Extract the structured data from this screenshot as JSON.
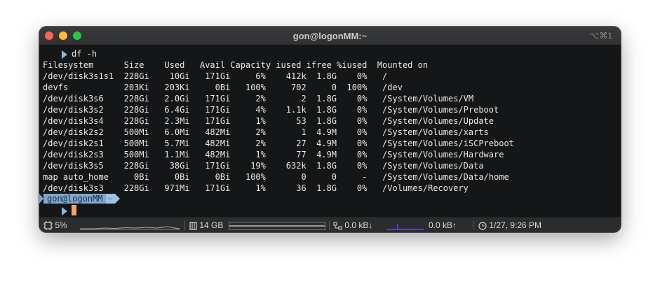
{
  "window": {
    "title": "gon@logonMM:~",
    "shortcut": "⌥⌘1"
  },
  "terminal": {
    "command": "df -h",
    "header": "Filesystem      Size    Used   Avail Capacity iused ifree %iused  Mounted on",
    "rows": [
      "/dev/disk3s1s1  228Gi    10Gi   171Gi     6%    412k  1.8G    0%   /",
      "devfs           203Ki   203Ki     0Bi   100%     702     0  100%   /dev",
      "/dev/disk3s6    228Gi   2.0Gi   171Gi     2%       2  1.8G    0%   /System/Volumes/VM",
      "/dev/disk3s2    228Gi   6.4Gi   171Gi     4%    1.1k  1.8G    0%   /System/Volumes/Preboot",
      "/dev/disk3s4    228Gi   2.3Mi   171Gi     1%      53  1.8G    0%   /System/Volumes/Update",
      "/dev/disk2s2    500Mi   6.0Mi   482Mi     2%       1  4.9M    0%   /System/Volumes/xarts",
      "/dev/disk2s1    500Mi   5.7Mi   482Mi     2%      27  4.9M    0%   /System/Volumes/iSCPreboot",
      "/dev/disk2s3    500Mi   1.1Mi   482Mi     1%      77  4.9M    0%   /System/Volumes/Hardware",
      "/dev/disk3s5    228Gi    38Gi   171Gi    19%    632k  1.8G    0%   /System/Volumes/Data",
      "map auto_home     0Bi     0Bi     0Bi   100%       0     0     -   /System/Volumes/Data/home",
      "/dev/disk3s3    228Gi   971Mi   171Gi     1%      36  1.8G    0%   /Volumes/Recovery"
    ],
    "prompt_user": "gon@logonMM",
    "prompt_dir": "~"
  },
  "statusbar": {
    "cpu": "5%",
    "memory": "14 GB",
    "network_down": "0.0 kB↓",
    "network_up": "0.0 kB↑",
    "clock": "1/27, 9:26 PM"
  },
  "colors": {
    "prompt_user_bg": "#7fa6cf",
    "prompt_dir_bg": "#9ec1e6",
    "cursor": "#f0a868",
    "network_graph": "#5b4bff"
  }
}
